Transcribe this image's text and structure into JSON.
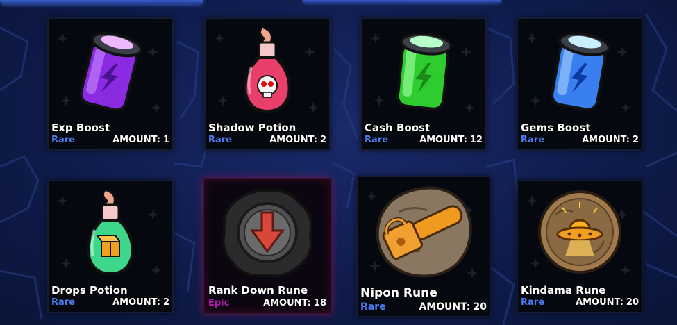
{
  "colors": {
    "rare": "#4a7bf0",
    "epic": "#b01ab0",
    "background": "#0e1a45"
  },
  "amount_label": "AMOUNT:",
  "items": [
    {
      "name": "Exp Boost",
      "rarity": "Rare",
      "amount": "1",
      "icon": "purple-jar-icon"
    },
    {
      "name": "Shadow Potion",
      "rarity": "Rare",
      "amount": "2",
      "icon": "skull-potion-icon"
    },
    {
      "name": "Cash Boost",
      "rarity": "Rare",
      "amount": "12",
      "icon": "green-jar-icon"
    },
    {
      "name": "Gems Boost",
      "rarity": "Rare",
      "amount": "2",
      "icon": "blue-jar-icon"
    },
    {
      "name": "Drops Potion",
      "rarity": "Rare",
      "amount": "2",
      "icon": "box-potion-icon"
    },
    {
      "name": "Rank Down Rune",
      "rarity": "Epic",
      "amount": "18",
      "icon": "down-arrow-rune-icon"
    },
    {
      "name": "Nipon Rune",
      "rarity": "Rare",
      "amount": "20",
      "icon": "chainsaw-rune-icon"
    },
    {
      "name": "Kindama Rune",
      "rarity": "Rare",
      "amount": "20",
      "icon": "ufo-rune-icon"
    }
  ]
}
